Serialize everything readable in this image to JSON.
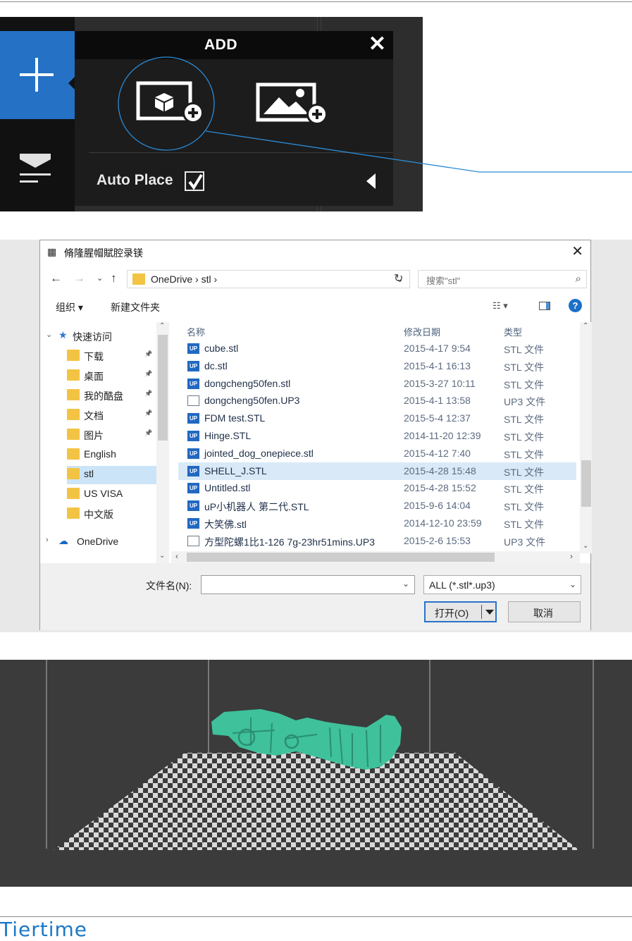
{
  "add_menu": {
    "title": "ADD",
    "close_glyph": "✕",
    "add_model_icon": "cube-plus-icon",
    "add_image_icon": "image-plus-icon",
    "auto_place_label": "Auto Place",
    "auto_place_checked": true,
    "accent_color": "#2471c5"
  },
  "dialog": {
    "title": "脩隆腥帽賦腔录镁",
    "nav": {
      "crumbs": "OneDrive  ›  stl  ›",
      "search_placeholder": "搜索\"stl\""
    },
    "toolbar": {
      "organize": "组织 ▾",
      "new_folder": "新建文件夹",
      "help": "?"
    },
    "sidebar": {
      "quick_access": "快速访问",
      "items": [
        {
          "label": "下载",
          "pinned": true
        },
        {
          "label": "桌面",
          "pinned": true
        },
        {
          "label": "我的酷盘",
          "pinned": true
        },
        {
          "label": "文档",
          "pinned": true
        },
        {
          "label": "图片",
          "pinned": true
        },
        {
          "label": "English",
          "pinned": false
        },
        {
          "label": "stl",
          "pinned": false
        },
        {
          "label": "US VISA",
          "pinned": false
        },
        {
          "label": "中文版",
          "pinned": false
        }
      ],
      "onedrive": "OneDrive"
    },
    "columns": {
      "name": "名称",
      "date": "修改日期",
      "type": "类型"
    },
    "files": [
      {
        "name": "cube.stl",
        "date": "2015-4-17 9:54",
        "type": "STL 文件",
        "icon": "stl"
      },
      {
        "name": "dc.stl",
        "date": "2015-4-1 16:13",
        "type": "STL 文件",
        "icon": "stl"
      },
      {
        "name": "dongcheng50fen.stl",
        "date": "2015-3-27 10:11",
        "type": "STL 文件",
        "icon": "stl"
      },
      {
        "name": "dongcheng50fen.UP3",
        "date": "2015-4-1 13:58",
        "type": "UP3 文件",
        "icon": "up3"
      },
      {
        "name": "FDM test.STL",
        "date": "2015-5-4 12:37",
        "type": "STL 文件",
        "icon": "stl"
      },
      {
        "name": "Hinge.STL",
        "date": "2014-11-20 12:39",
        "type": "STL 文件",
        "icon": "stl"
      },
      {
        "name": "jointed_dog_onepiece.stl",
        "date": "2015-4-12 7:40",
        "type": "STL 文件",
        "icon": "stl"
      },
      {
        "name": "SHELL_J.STL",
        "date": "2015-4-28 15:48",
        "type": "STL 文件",
        "icon": "stl"
      },
      {
        "name": "Untitled.stl",
        "date": "2015-4-28 15:52",
        "type": "STL 文件",
        "icon": "stl"
      },
      {
        "name": "uP小机器人  第二代.STL",
        "date": "2015-9-6 14:04",
        "type": "STL 文件",
        "icon": "stl"
      },
      {
        "name": "大笑佛.stl",
        "date": "2014-12-10 23:59",
        "type": "STL 文件",
        "icon": "stl"
      },
      {
        "name": "方型陀螺1比1-126 7g-23hr51mins.UP3",
        "date": "2015-2-6 15:53",
        "type": "UP3 文件",
        "icon": "up3"
      }
    ],
    "selected_file": "SHELL_J.STL",
    "file_icon_text": "UP",
    "filename_label": "文件名(N):",
    "filename_value": "",
    "filetype_value": "ALL (*.stl*.up3)",
    "open_label": "打开(O)",
    "cancel_label": "取消"
  },
  "viewport": {
    "model_color": "#3fc19c",
    "background": "#3b3b3b"
  },
  "footer": {
    "logo": "Tiertime",
    "logo_color": "#1a78c8"
  }
}
